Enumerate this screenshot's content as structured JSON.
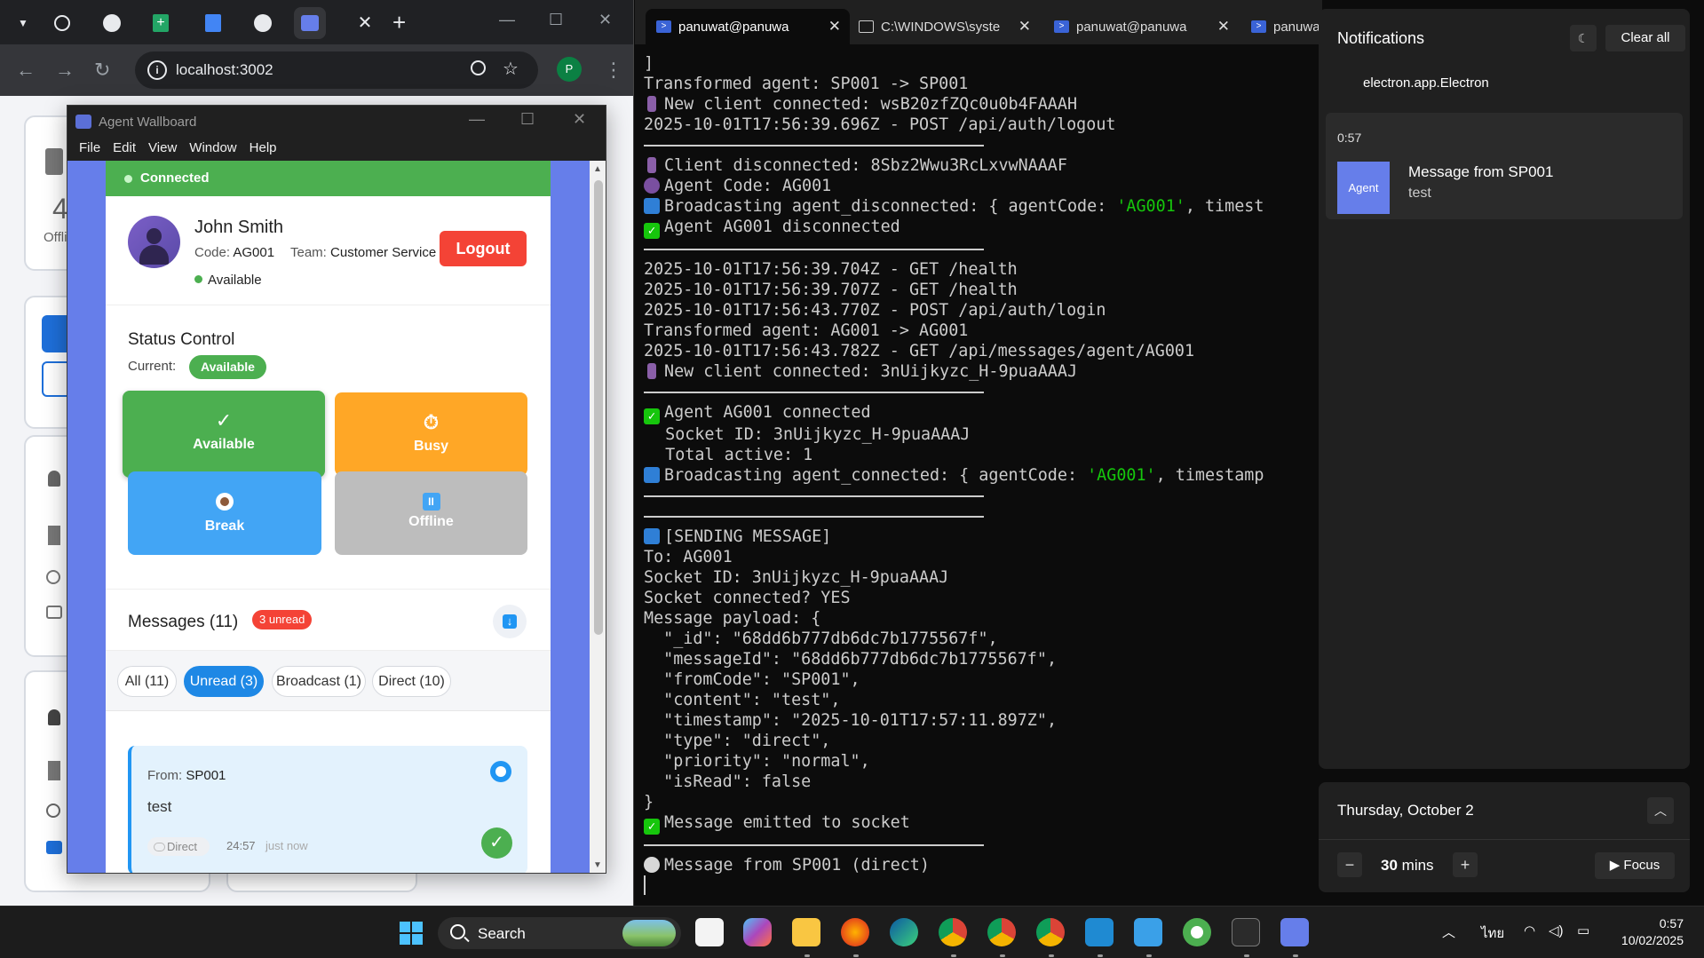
{
  "browser": {
    "url": "localhost:3002",
    "profile_initial": "P",
    "bg_cards": {
      "count_partial": "4",
      "status_partial": "Offli"
    }
  },
  "app": {
    "window_title": "Agent Wallboard",
    "menu": [
      "File",
      "Edit",
      "View",
      "Window",
      "Help"
    ],
    "connection": "Connected",
    "agent": {
      "name": "John Smith",
      "code_label": "Code:",
      "code": "AG001",
      "team_label": "Team:",
      "team": "Customer Service",
      "status": "Available",
      "logout_label": "Logout"
    },
    "status_control": {
      "title": "Status Control",
      "current_label": "Current:",
      "current": "Available",
      "buttons": [
        {
          "label": "Available",
          "icon": "check-icon"
        },
        {
          "label": "Busy",
          "icon": "stopwatch-icon"
        },
        {
          "label": "Break",
          "icon": "coffee-icon"
        },
        {
          "label": "Offline",
          "icon": "pause-icon"
        }
      ],
      "check_glyph": "✓",
      "busy_glyph": "⏱",
      "pause_glyph": "II"
    },
    "messages": {
      "title": "Messages (11)",
      "unread_badge": "3 unread",
      "download_glyph": "↓",
      "filters": [
        "All (11)",
        "Unread (3)",
        "Broadcast (1)",
        "Direct (10)"
      ],
      "active_filter": "Unread (3)",
      "items": [
        {
          "from_label": "From:",
          "from": "SP001",
          "content": "test",
          "type": "Direct",
          "time": "24:57",
          "ago": "just now",
          "check_glyph": "✓"
        }
      ]
    }
  },
  "terminal": {
    "tabs": [
      {
        "label": "panuwat@panuwa",
        "kind": "powershell",
        "active": true
      },
      {
        "label": "C:\\WINDOWS\\syste",
        "kind": "cmd",
        "active": false
      },
      {
        "label": "panuwat@panuwa",
        "kind": "powershell",
        "active": false
      },
      {
        "label": "panuwa",
        "kind": "powershell",
        "active": false
      }
    ],
    "lines": {
      "l01": "]",
      "l02": "Transformed agent: SP001 -> SP001",
      "l03": "New client connected: wsB20zfZQc0u0b4FAAAH",
      "l04": "2025-10-01T17:56:39.696Z - POST /api/auth/logout",
      "l06": "Client disconnected: 8Sbz2Wwu3RcLxvwNAAAF",
      "l07": "Agent Code: AG001",
      "l08a": "Broadcasting agent_disconnected: { agentCode: ",
      "l08b": "'AG001'",
      "l08c": ", timest",
      "l09": "Agent AG001 disconnected",
      "l11": "2025-10-01T17:56:39.704Z - GET /health",
      "l12": "2025-10-01T17:56:39.707Z - GET /health",
      "l13": "2025-10-01T17:56:43.770Z - POST /api/auth/login",
      "l14": "Transformed agent: AG001 -> AG001",
      "l15": "2025-10-01T17:56:43.782Z - GET /api/messages/agent/AG001",
      "l16": "New client connected: 3nUijkyzc_H-9puaAAAJ",
      "l18": "Agent AG001 connected",
      "l19": "  Socket ID: 3nUijkyzc_H-9puaAAAJ",
      "l20": "  Total active: 1",
      "l21a": "Broadcasting agent_connected: { agentCode: ",
      "l21b": "'AG001'",
      "l21c": ", timestamp",
      "l24": "[SENDING MESSAGE]",
      "l25": "To: AG001",
      "l26": "Socket ID: 3nUijkyzc_H-9puaAAAJ",
      "l27": "Socket connected? YES",
      "l28": "Message payload: {",
      "l29": "  \"_id\": \"68dd6b777db6dc7b1775567f\",",
      "l30": "  \"messageId\": \"68dd6b777db6dc7b1775567f\",",
      "l31": "  \"fromCode\": \"SP001\",",
      "l32": "  \"content\": \"test\",",
      "l33": "  \"timestamp\": \"2025-10-01T17:57:11.897Z\",",
      "l34": "  \"type\": \"direct\",",
      "l35": "  \"priority\": \"normal\",",
      "l36": "  \"isRead\": false",
      "l37": "}",
      "l38": "Message emitted to socket",
      "l40": "Message from SP001 (direct)"
    }
  },
  "notifications": {
    "title": "Notifications",
    "clear_all": "Clear all",
    "app_name": "electron.app.Electron",
    "item": {
      "time": "0:57",
      "icon_label": "Agent",
      "title": "Message from SP001",
      "body": "test"
    }
  },
  "calendar": {
    "date": "Thursday, October 2",
    "focus_value": "30",
    "focus_unit": "mins",
    "focus_label": "Focus"
  },
  "taskbar": {
    "search_label": "Search",
    "language": "ไทย",
    "time": "0:57",
    "date": "10/02/2025"
  }
}
